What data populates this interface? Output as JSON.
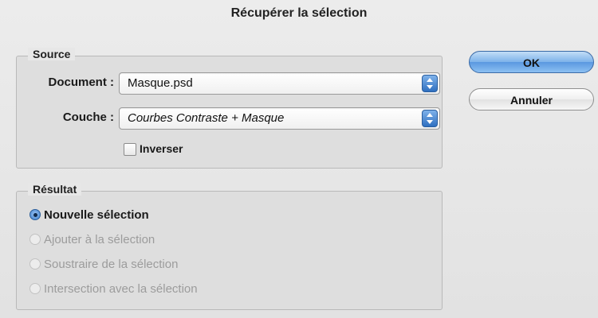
{
  "dialog": {
    "title": "Récupérer la sélection",
    "source": {
      "legend": "Source",
      "document_label": "Document :",
      "document_value": "Masque.psd",
      "channel_label": "Couche :",
      "channel_value": "Courbes Contraste + Masque",
      "invert_label": "Inverser",
      "invert_checked": false
    },
    "result": {
      "legend": "Résultat",
      "options": [
        {
          "label": "Nouvelle sélection",
          "selected": true,
          "enabled": true
        },
        {
          "label": "Ajouter à la sélection",
          "selected": false,
          "enabled": false
        },
        {
          "label": "Soustraire de la sélection",
          "selected": false,
          "enabled": false
        },
        {
          "label": "Intersection avec la sélection",
          "selected": false,
          "enabled": false
        }
      ]
    },
    "buttons": {
      "ok_label": "OK",
      "cancel_label": "Annuler"
    }
  },
  "colors": {
    "accent": "#5a98e0",
    "disabled_text": "#9c9c9c"
  }
}
